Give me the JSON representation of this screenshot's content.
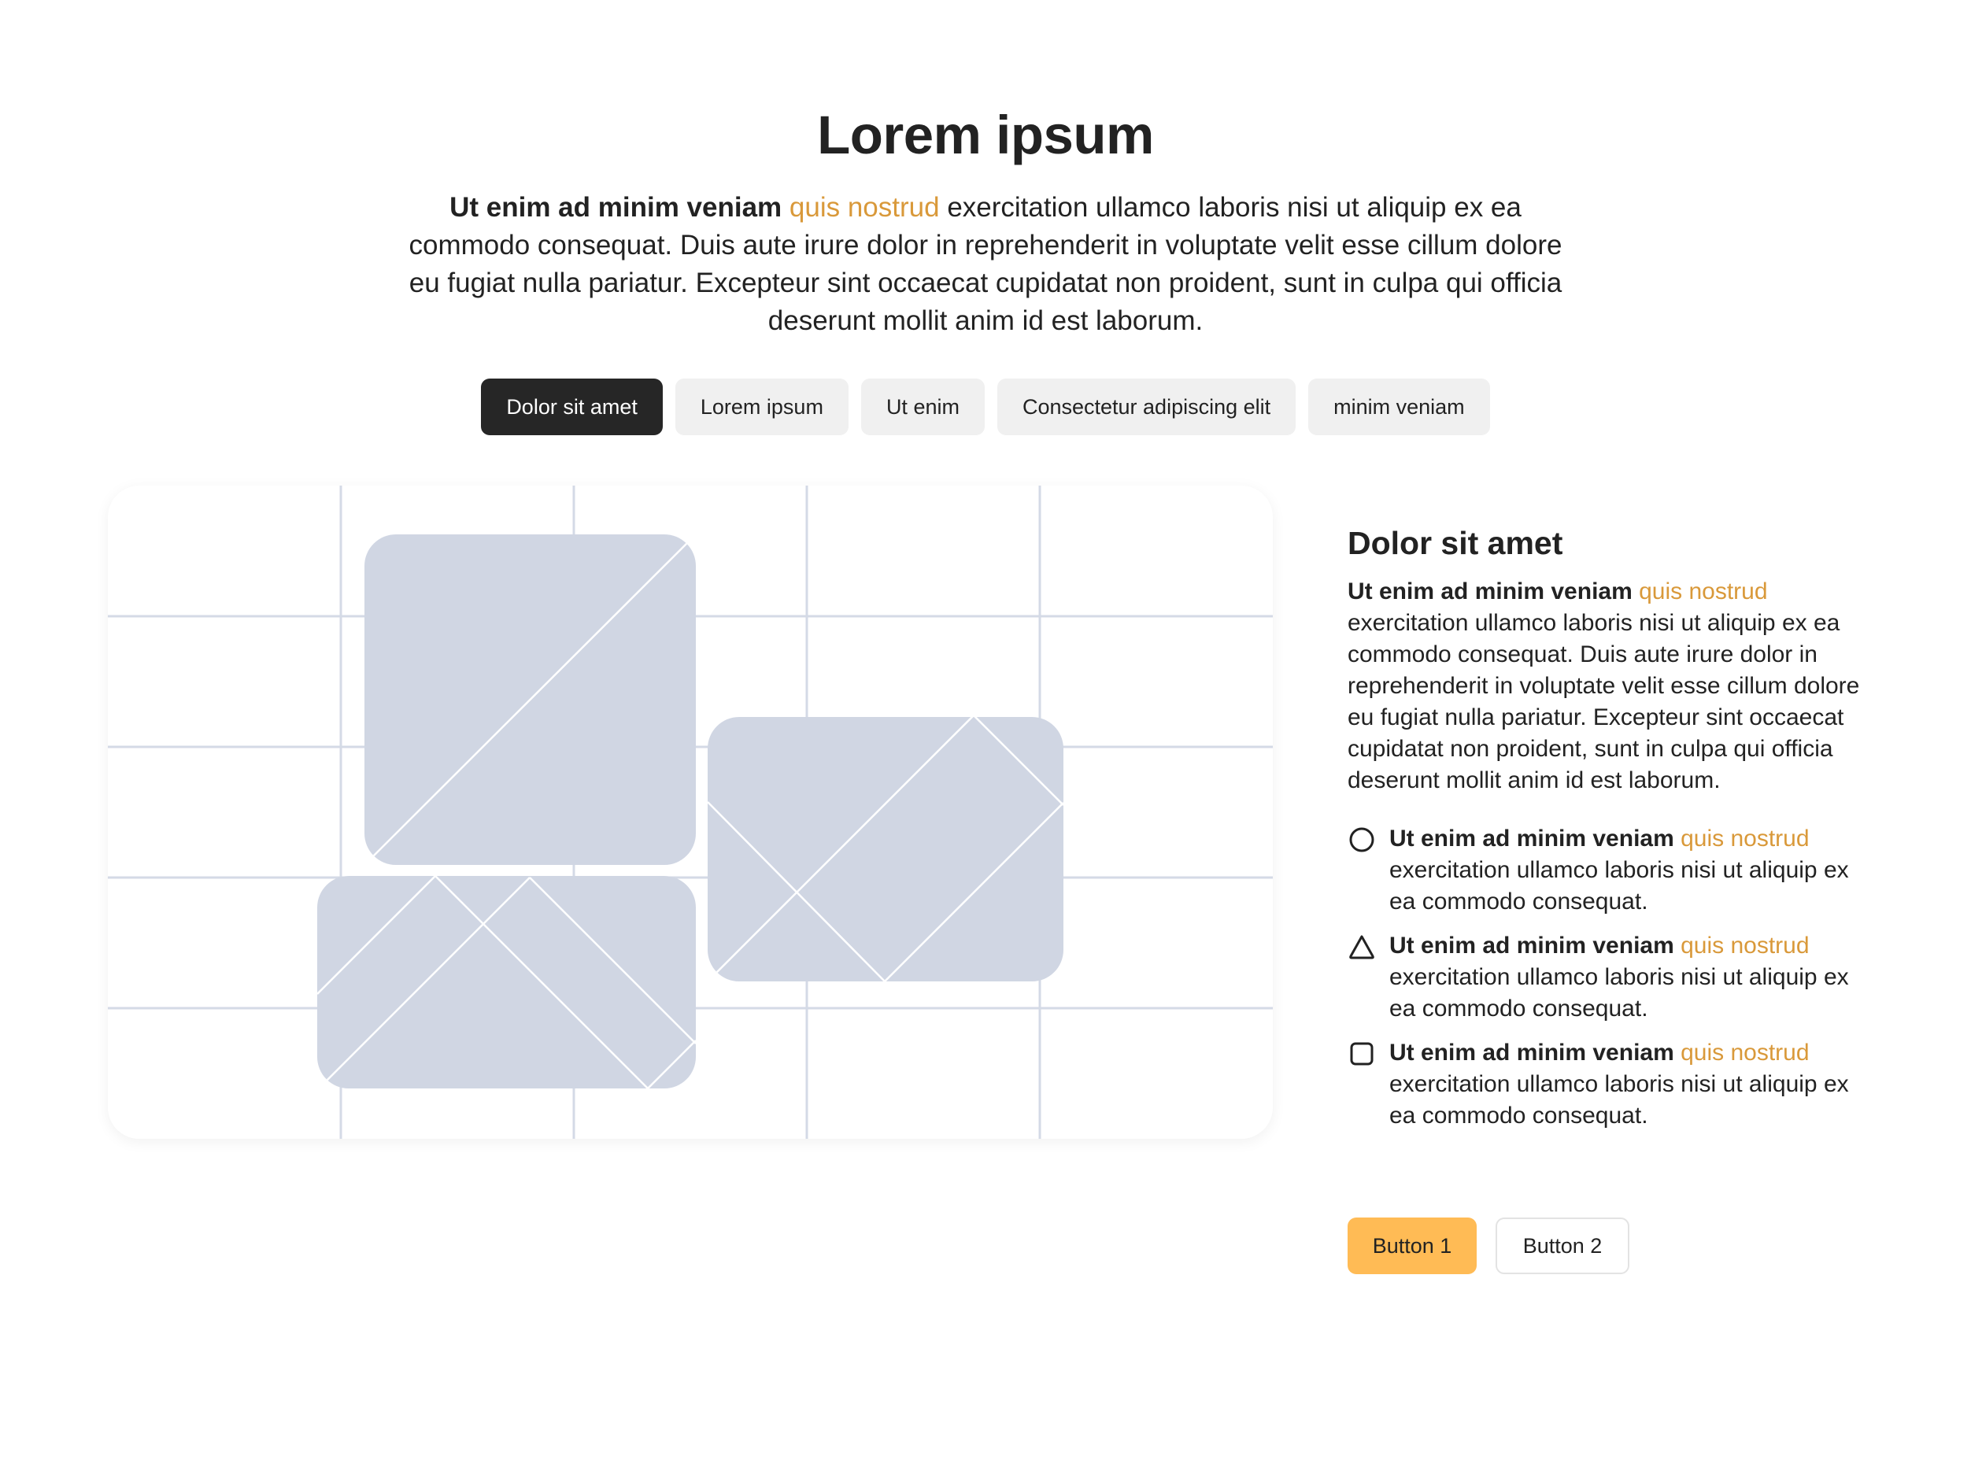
{
  "hero": {
    "title": "Lorem ipsum",
    "intro_bold": "Ut enim ad minim veniam",
    "intro_accent": "quis nostrud",
    "intro_rest": "exercitation ullamco laboris nisi ut aliquip ex ea commodo consequat. Duis aute irure dolor in reprehenderit in voluptate velit esse cillum dolore eu fugiat nulla pariatur. Excepteur sint occaecat cupidatat non proident, sunt in culpa qui officia deserunt mollit anim id est laborum."
  },
  "tabs": [
    {
      "label": "Dolor sit amet",
      "active": true
    },
    {
      "label": "Lorem ipsum",
      "active": false
    },
    {
      "label": "Ut enim",
      "active": false
    },
    {
      "label": "Consectetur adipiscing elit",
      "active": false
    },
    {
      "label": "minim veniam",
      "active": false
    }
  ],
  "media": {
    "icon": "image-placeholder-icon",
    "grid_color": "#d4dae6",
    "placeholder_color": "#d0d6e3"
  },
  "side": {
    "title": "Dolor sit amet",
    "text_bold": "Ut enim ad minim veniam",
    "text_accent": "quis nostrud",
    "text_rest": "exercitation ullamco laboris nisi ut aliquip ex ea commodo consequat. Duis aute irure dolor in reprehenderit in voluptate velit esse cillum dolore eu fugiat nulla pariatur. Excepteur sint occaecat cupidatat non proident, sunt in culpa qui officia deserunt mollit anim id est laborum.",
    "features": [
      {
        "icon": "circle-icon",
        "bold": "Ut enim ad minim veniam",
        "accent": "quis nostrud",
        "rest": "exercitation ullamco laboris nisi ut aliquip ex ea commodo consequat."
      },
      {
        "icon": "triangle-icon",
        "bold": "Ut enim ad minim veniam",
        "accent": "quis nostrud",
        "rest": "exercitation ullamco laboris nisi ut aliquip ex ea commodo consequat."
      },
      {
        "icon": "square-icon",
        "bold": "Ut enim ad minim veniam",
        "accent": "quis nostrud",
        "rest": "exercitation ullamco laboris nisi ut aliquip ex ea commodo consequat."
      }
    ]
  },
  "buttons": {
    "primary_label": "Button 1",
    "secondary_label": "Button 2"
  },
  "colors": {
    "accent": "#d9993a",
    "primary_button": "#ffbb55",
    "active_tab": "#262626",
    "inactive_tab": "#f0f0f0"
  }
}
